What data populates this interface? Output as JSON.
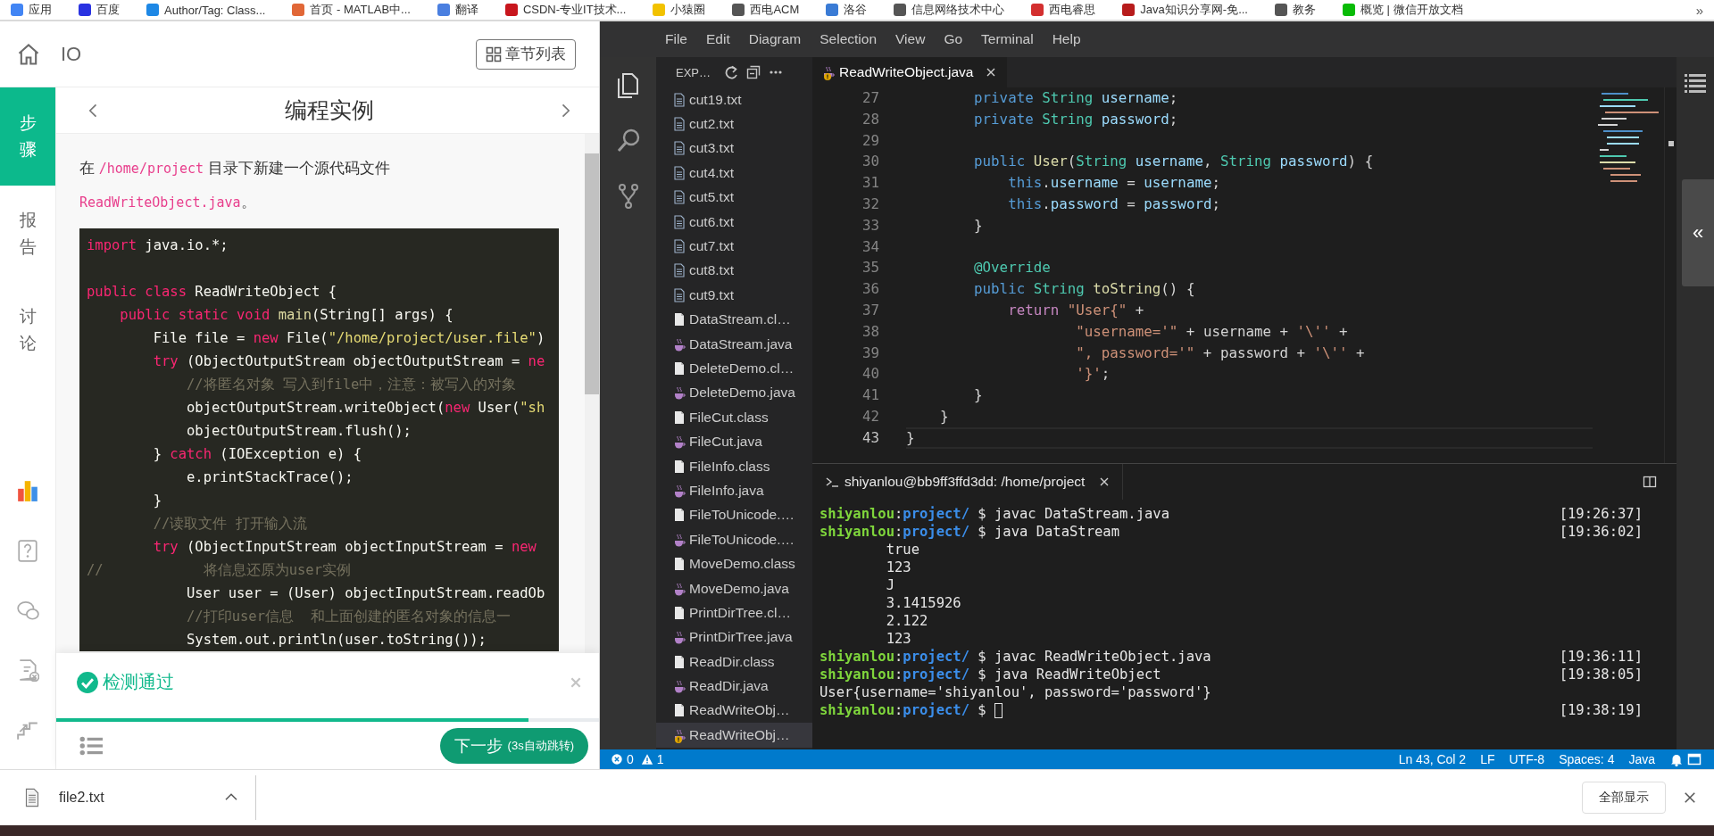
{
  "bookmarks": {
    "items": [
      {
        "label": "应用",
        "color": "#4285f4"
      },
      {
        "label": "百度",
        "color": "#2932e1"
      },
      {
        "label": "Author/Tag: Class...",
        "color": "#1e88e5"
      },
      {
        "label": "首页 - MATLAB中...",
        "color": "#e16737"
      },
      {
        "label": "翻译",
        "color": "#4a7fe0"
      },
      {
        "label": "CSDN-专业IT技术...",
        "color": "#c8161d"
      },
      {
        "label": "小猿圈",
        "color": "#f2c200"
      },
      {
        "label": "西电ACM",
        "color": "#555555"
      },
      {
        "label": "洛谷",
        "color": "#3a7bd5"
      },
      {
        "label": "信息网络技术中心",
        "color": "#555555"
      },
      {
        "label": "西电睿思",
        "color": "#d32f2f"
      },
      {
        "label": "Java知识分享网-免...",
        "color": "#b71c1c"
      },
      {
        "label": "教务",
        "color": "#555555"
      },
      {
        "label": "概览 | 微信开放文档",
        "color": "#09bb07"
      }
    ],
    "more": "»"
  },
  "course": {
    "title": "IO",
    "chapters_button": "章节列表"
  },
  "nav": {
    "items": [
      {
        "label": "步骤",
        "selected": true
      },
      {
        "label": "报告",
        "selected": false
      },
      {
        "label": "讨论",
        "selected": false
      }
    ]
  },
  "step": {
    "title": "编程实例",
    "intro": [
      {
        "kind": "text",
        "text": "在 "
      },
      {
        "kind": "code",
        "text": "/home/project"
      },
      {
        "kind": "text",
        "text": " 目录下新建一个源代码文件"
      },
      {
        "kind": "code",
        "text": "ReadWriteObject.java"
      },
      {
        "kind": "text",
        "text": "。"
      }
    ],
    "code": [
      {
        "kind": "code",
        "tokens": [
          {
            "kind": "kw",
            "text": "import"
          },
          {
            "kind": "plain",
            "text": " java.io.*;"
          }
        ]
      },
      {
        "kind": "blank"
      },
      {
        "kind": "code",
        "tokens": [
          {
            "kind": "kw",
            "text": "public class "
          },
          {
            "kind": "plain",
            "text": "ReadWriteObject {"
          }
        ]
      },
      {
        "kind": "code",
        "tokens": [
          {
            "kind": "kw",
            "text": "    public static void "
          },
          {
            "kind": "fn",
            "text": "main"
          },
          {
            "kind": "plain",
            "text": "(String[] args) {"
          }
        ]
      },
      {
        "kind": "code",
        "tokens": [
          {
            "kind": "plain",
            "text": "        File file = "
          },
          {
            "kind": "kw",
            "text": "new "
          },
          {
            "kind": "plain",
            "text": "File("
          },
          {
            "kind": "str",
            "text": "\"/home/project/user.file\""
          },
          {
            "kind": "plain",
            "text": ")"
          }
        ]
      },
      {
        "kind": "code",
        "tokens": [
          {
            "kind": "kw",
            "text": "        try "
          },
          {
            "kind": "plain",
            "text": "(ObjectOutputStream objectOutputStream = "
          },
          {
            "kind": "kw",
            "text": "ne"
          }
        ]
      },
      {
        "kind": "code",
        "tokens": [
          {
            "kind": "cmt",
            "text": "            //将匿名对象 写入到file中，注意：被写入的对象"
          }
        ]
      },
      {
        "kind": "code",
        "tokens": [
          {
            "kind": "plain",
            "text": "            objectOutputStream.writeObject("
          },
          {
            "kind": "kw",
            "text": "new "
          },
          {
            "kind": "plain",
            "text": "User("
          },
          {
            "kind": "str",
            "text": "\"sh"
          }
        ]
      },
      {
        "kind": "code",
        "tokens": [
          {
            "kind": "plain",
            "text": "            objectOutputStream.flush();"
          }
        ]
      },
      {
        "kind": "code",
        "tokens": [
          {
            "kind": "plain",
            "text": "        } "
          },
          {
            "kind": "kw",
            "text": "catch "
          },
          {
            "kind": "plain",
            "text": "(IOException e) {"
          }
        ]
      },
      {
        "kind": "code",
        "tokens": [
          {
            "kind": "plain",
            "text": "            e.printStackTrace();"
          }
        ]
      },
      {
        "kind": "code",
        "tokens": [
          {
            "kind": "plain",
            "text": "        }"
          }
        ]
      },
      {
        "kind": "code",
        "tokens": [
          {
            "kind": "cmt",
            "text": "        //读取文件 打开输入流"
          }
        ]
      },
      {
        "kind": "code",
        "tokens": [
          {
            "kind": "kw",
            "text": "        try "
          },
          {
            "kind": "plain",
            "text": "(ObjectInputStream objectInputStream = "
          },
          {
            "kind": "kw",
            "text": "new"
          }
        ]
      },
      {
        "kind": "code",
        "tokens": [
          {
            "kind": "cmt",
            "text": "//            将信息还原为user实例"
          }
        ]
      },
      {
        "kind": "code",
        "tokens": [
          {
            "kind": "plain",
            "text": "            User user = (User) objectInputStream.readOb"
          }
        ]
      },
      {
        "kind": "code",
        "tokens": [
          {
            "kind": "cmt",
            "text": "            //打印user信息  和上面创建的匿名对象的信息一"
          }
        ]
      },
      {
        "kind": "code",
        "tokens": [
          {
            "kind": "plain",
            "text": "            System.out.println(user.toString());"
          }
        ]
      }
    ]
  },
  "check": {
    "status": "检测通过",
    "level": 0.87,
    "next_button": "下一步",
    "countdown": "(3s自动跳转)"
  },
  "downloads": {
    "file": "file2.txt",
    "show_all": "全部显示"
  },
  "vscode": {
    "menu": [
      "File",
      "Edit",
      "Diagram",
      "Selection",
      "View",
      "Go",
      "Terminal",
      "Help"
    ],
    "explorer": {
      "title": "EXP…",
      "files": [
        {
          "name": "cut19.txt",
          "kind": "txt",
          "selected": false,
          "warning": false
        },
        {
          "name": "cut2.txt",
          "kind": "txt",
          "selected": false,
          "warning": false
        },
        {
          "name": "cut3.txt",
          "kind": "txt",
          "selected": false,
          "warning": false
        },
        {
          "name": "cut4.txt",
          "kind": "txt",
          "selected": false,
          "warning": false
        },
        {
          "name": "cut5.txt",
          "kind": "txt",
          "selected": false,
          "warning": false
        },
        {
          "name": "cut6.txt",
          "kind": "txt",
          "selected": false,
          "warning": false
        },
        {
          "name": "cut7.txt",
          "kind": "txt",
          "selected": false,
          "warning": false
        },
        {
          "name": "cut8.txt",
          "kind": "txt",
          "selected": false,
          "warning": false
        },
        {
          "name": "cut9.txt",
          "kind": "txt",
          "selected": false,
          "warning": false
        },
        {
          "name": "DataStream.cl…",
          "kind": "class",
          "selected": false,
          "warning": false
        },
        {
          "name": "DataStream.java",
          "kind": "java",
          "selected": false,
          "warning": false
        },
        {
          "name": "DeleteDemo.cl…",
          "kind": "class",
          "selected": false,
          "warning": false
        },
        {
          "name": "DeleteDemo.java",
          "kind": "java",
          "selected": false,
          "warning": false
        },
        {
          "name": "FileCut.class",
          "kind": "class",
          "selected": false,
          "warning": false
        },
        {
          "name": "FileCut.java",
          "kind": "java",
          "selected": false,
          "warning": false
        },
        {
          "name": "FileInfo.class",
          "kind": "class",
          "selected": false,
          "warning": false
        },
        {
          "name": "FileInfo.java",
          "kind": "java",
          "selected": false,
          "warning": false
        },
        {
          "name": "FileToUnicode.…",
          "kind": "class",
          "selected": false,
          "warning": false
        },
        {
          "name": "FileToUnicode.…",
          "kind": "java",
          "selected": false,
          "warning": false
        },
        {
          "name": "MoveDemo.class",
          "kind": "class",
          "selected": false,
          "warning": false
        },
        {
          "name": "MoveDemo.java",
          "kind": "java",
          "selected": false,
          "warning": false
        },
        {
          "name": "PrintDirTree.cl…",
          "kind": "class",
          "selected": false,
          "warning": false
        },
        {
          "name": "PrintDirTree.java",
          "kind": "java",
          "selected": false,
          "warning": false
        },
        {
          "name": "ReadDir.class",
          "kind": "class",
          "selected": false,
          "warning": false
        },
        {
          "name": "ReadDir.java",
          "kind": "java",
          "selected": false,
          "warning": false
        },
        {
          "name": "ReadWriteObj…",
          "kind": "class",
          "selected": false,
          "warning": false
        },
        {
          "name": "ReadWriteObj…",
          "kind": "java",
          "selected": true,
          "warning": true
        }
      ]
    },
    "tab": {
      "name": "ReadWriteObject.java",
      "warning": true
    },
    "editor_lines": [
      {
        "number": "27",
        "current": false,
        "tokens": [
          {
            "kind": "kw",
            "text": "        private "
          },
          {
            "kind": "type",
            "text": "String "
          },
          {
            "kind": "var",
            "text": "username"
          },
          {
            "kind": "plain",
            "text": ";"
          }
        ]
      },
      {
        "number": "28",
        "current": false,
        "tokens": [
          {
            "kind": "kw",
            "text": "        private "
          },
          {
            "kind": "type",
            "text": "String "
          },
          {
            "kind": "var",
            "text": "password"
          },
          {
            "kind": "plain",
            "text": ";"
          }
        ]
      },
      {
        "number": "29",
        "current": false
      },
      {
        "number": "30",
        "current": false,
        "tokens": [
          {
            "kind": "kw",
            "text": "        public "
          },
          {
            "kind": "fn",
            "text": "User"
          },
          {
            "kind": "plain",
            "text": "("
          },
          {
            "kind": "type",
            "text": "String "
          },
          {
            "kind": "var",
            "text": "username"
          },
          {
            "kind": "plain",
            "text": ", "
          },
          {
            "kind": "type",
            "text": "String "
          },
          {
            "kind": "var",
            "text": "password"
          },
          {
            "kind": "plain",
            "text": ") {"
          }
        ]
      },
      {
        "number": "31",
        "current": false,
        "tokens": [
          {
            "kind": "kw",
            "text": "            this"
          },
          {
            "kind": "plain",
            "text": "."
          },
          {
            "kind": "var",
            "text": "username"
          },
          {
            "kind": "plain",
            "text": " = "
          },
          {
            "kind": "var",
            "text": "username"
          },
          {
            "kind": "plain",
            "text": ";"
          }
        ]
      },
      {
        "number": "32",
        "current": false,
        "tokens": [
          {
            "kind": "kw",
            "text": "            this"
          },
          {
            "kind": "plain",
            "text": "."
          },
          {
            "kind": "var",
            "text": "password"
          },
          {
            "kind": "plain",
            "text": " = "
          },
          {
            "kind": "var",
            "text": "password"
          },
          {
            "kind": "plain",
            "text": ";"
          }
        ]
      },
      {
        "number": "33",
        "current": false,
        "tokens": [
          {
            "kind": "plain",
            "text": "        }"
          }
        ]
      },
      {
        "number": "34",
        "current": false
      },
      {
        "number": "35",
        "current": false,
        "tokens": [
          {
            "kind": "ann",
            "text": "        @Override"
          }
        ]
      },
      {
        "number": "36",
        "current": false,
        "tokens": [
          {
            "kind": "kw",
            "text": "        public "
          },
          {
            "kind": "type",
            "text": "String "
          },
          {
            "kind": "fn",
            "text": "toString"
          },
          {
            "kind": "plain",
            "text": "() {"
          }
        ]
      },
      {
        "number": "37",
        "current": false,
        "tokens": [
          {
            "kind": "ctrl",
            "text": "            return "
          },
          {
            "kind": "str",
            "text": "\"User{\""
          },
          {
            "kind": "plain",
            "text": " +"
          }
        ]
      },
      {
        "number": "38",
        "current": false,
        "tokens": [
          {
            "kind": "str",
            "text": "                    \"username='\""
          },
          {
            "kind": "plain",
            "text": " + username + "
          },
          {
            "kind": "str",
            "text": "'\\''"
          },
          {
            "kind": "plain",
            "text": " +"
          }
        ]
      },
      {
        "number": "39",
        "current": false,
        "tokens": [
          {
            "kind": "str",
            "text": "                    \", password='\""
          },
          {
            "kind": "plain",
            "text": " + password + "
          },
          {
            "kind": "str",
            "text": "'\\''"
          },
          {
            "kind": "plain",
            "text": " +"
          }
        ]
      },
      {
        "number": "40",
        "current": false,
        "tokens": [
          {
            "kind": "str",
            "text": "                    '}'"
          },
          {
            "kind": "plain",
            "text": ";"
          }
        ]
      },
      {
        "number": "41",
        "current": false,
        "tokens": [
          {
            "kind": "plain",
            "text": "        }"
          }
        ]
      },
      {
        "number": "42",
        "current": false,
        "tokens": [
          {
            "kind": "plain",
            "text": "    }"
          }
        ]
      },
      {
        "number": "43",
        "current": true,
        "tokens": [
          {
            "kind": "plain",
            "text": "}"
          }
        ]
      }
    ],
    "side_handle": "«",
    "terminal": {
      "title": "shiyanlou@bb9ff3ffd3dd: /home/project",
      "lines": [
        {
          "kind": "prompt",
          "user": "shiyanlou",
          "separator": ":",
          "dir": "project/",
          "symbol": "$",
          "command": "javac DataStream.java",
          "time": "[19:26:37]",
          "cursor": false
        },
        {
          "kind": "prompt",
          "user": "shiyanlou",
          "separator": ":",
          "dir": "project/",
          "symbol": "$",
          "command": "java DataStream",
          "time": "[19:36:02]",
          "cursor": false
        },
        {
          "kind": "output",
          "text": "        true"
        },
        {
          "kind": "output",
          "text": "        123"
        },
        {
          "kind": "output",
          "text": "        J"
        },
        {
          "kind": "output",
          "text": "        3.1415926"
        },
        {
          "kind": "output",
          "text": "        2.122"
        },
        {
          "kind": "output",
          "text": "        123"
        },
        {
          "kind": "prompt",
          "user": "shiyanlou",
          "separator": ":",
          "dir": "project/",
          "symbol": "$",
          "command": "javac ReadWriteObject.java",
          "time": "[19:36:11]",
          "cursor": false
        },
        {
          "kind": "prompt",
          "user": "shiyanlou",
          "separator": ":",
          "dir": "project/",
          "symbol": "$",
          "command": "java ReadWriteObject",
          "time": "[19:38:05]",
          "cursor": false
        },
        {
          "kind": "output",
          "text": "User{username='shiyanlou', password='password'}"
        },
        {
          "kind": "prompt",
          "user": "shiyanlou",
          "separator": ":",
          "dir": "project/",
          "symbol": "$",
          "time": "[19:38:19]",
          "cursor": true
        }
      ]
    },
    "status_bar": {
      "errors": "0",
      "warnings": "1",
      "items": [
        "Ln 43, Col 2",
        "LF",
        "UTF-8",
        "Spaces: 4",
        "Java"
      ]
    }
  }
}
